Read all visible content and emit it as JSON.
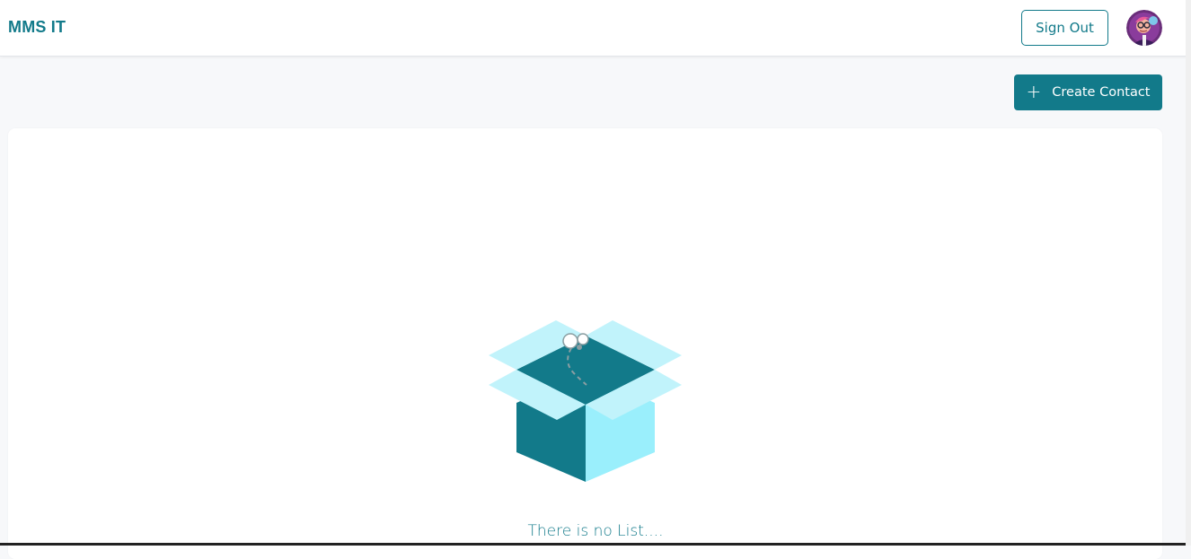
{
  "header": {
    "brand": "MMS IT",
    "sign_out_label": "Sign Out",
    "avatar_icon": "user-avatar"
  },
  "toolbar": {
    "create_label": "Create Contact",
    "create_icon": "plus-icon"
  },
  "main": {
    "empty_message": "There is no List....",
    "empty_icon": "open-box-icon"
  },
  "colors": {
    "accent": "#127a8a",
    "box_light": "#c1f3fb",
    "box_side": "#9aeffc",
    "background": "#f7f8fa"
  }
}
